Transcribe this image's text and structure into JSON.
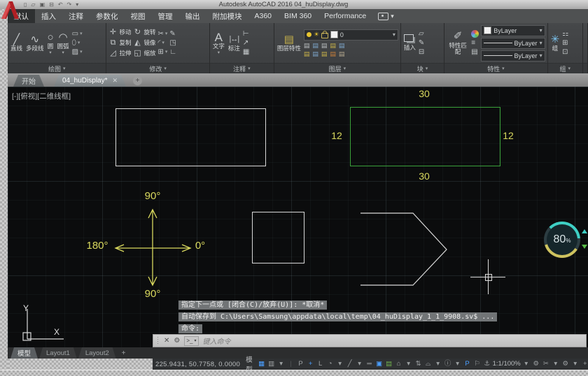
{
  "titlebar": {
    "title": "Autodesk AutoCAD 2016   04_huDisplay.dwg",
    "quick_icons": [
      {
        "name": "new",
        "glyph": "▯"
      },
      {
        "name": "open",
        "glyph": "▱"
      },
      {
        "name": "save",
        "glyph": "▣"
      },
      {
        "name": "plot",
        "glyph": "⊟"
      },
      {
        "name": "undo",
        "glyph": "↶"
      },
      {
        "name": "redo",
        "glyph": "↷"
      },
      {
        "name": "qat-dropdown",
        "glyph": "▾"
      }
    ]
  },
  "ribbon_tabs": [
    {
      "label": "默认"
    },
    {
      "label": "插入"
    },
    {
      "label": "注释"
    },
    {
      "label": "参数化"
    },
    {
      "label": "视图"
    },
    {
      "label": "管理"
    },
    {
      "label": "输出"
    },
    {
      "label": "附加模块"
    },
    {
      "label": "A360"
    },
    {
      "label": "BIM 360"
    },
    {
      "label": "Performance"
    }
  ],
  "ribbon": {
    "draw": {
      "panel_label": "绘图",
      "line": "直线",
      "line_glyph": "╱",
      "polyline": "多段线",
      "polyline_glyph": "∿",
      "circle": "圆",
      "circle_glyph": "○",
      "arc": "圆弧",
      "arc_glyph": "◠",
      "small": [
        {
          "name": "rectangle",
          "glyph": "▭"
        },
        {
          "name": "ellipse",
          "glyph": "⬯"
        },
        {
          "name": "hatch",
          "glyph": "▨"
        }
      ]
    },
    "modify": {
      "panel_label": "修改",
      "col1": [
        {
          "name": "move",
          "glyph": "✛",
          "label": "移动"
        },
        {
          "name": "copy",
          "glyph": "⧉",
          "label": "复制"
        },
        {
          "name": "stretch",
          "glyph": "◿",
          "label": "拉伸"
        }
      ],
      "col2": [
        {
          "name": "rotate",
          "glyph": "↻",
          "label": "旋转"
        },
        {
          "name": "mirror",
          "glyph": "◭",
          "label": "镜像"
        },
        {
          "name": "scale",
          "glyph": "◱",
          "label": "缩放"
        }
      ],
      "small": [
        {
          "name": "trim",
          "glyph": "✂"
        },
        {
          "name": "fillet",
          "glyph": "◜"
        },
        {
          "name": "array",
          "glyph": "⊞"
        }
      ],
      "extra": [
        {
          "name": "erase",
          "glyph": "✎"
        },
        {
          "name": "explode",
          "glyph": "◳"
        },
        {
          "name": "offset",
          "glyph": "∟"
        }
      ]
    },
    "annotate": {
      "panel_label": "注释",
      "text": "文字",
      "text_glyph": "A",
      "dimension": "标注",
      "small": [
        {
          "name": "dim-style",
          "glyph": "⊢"
        },
        {
          "name": "leader",
          "glyph": "↗"
        },
        {
          "name": "table",
          "glyph": "▦"
        }
      ]
    },
    "layers": {
      "panel_label": "图层",
      "properties": "图层特性",
      "properties_glyph": "▤",
      "current_layer": "0",
      "tools_row1": [
        {
          "name": "off",
          "glyph": "▤",
          "color": "#b9bdbf"
        },
        {
          "name": "isolate",
          "glyph": "▤",
          "color": "#7ea7cc"
        },
        {
          "name": "freeze",
          "glyph": "▤",
          "color": "#b9bdbf"
        },
        {
          "name": "lock",
          "glyph": "▤",
          "color": "#c8b24a"
        },
        {
          "name": "make-current",
          "glyph": "▤",
          "color": "#7ea7cc"
        }
      ],
      "tools_row2": [
        {
          "name": "on",
          "glyph": "▤",
          "color": "#c8b24a"
        },
        {
          "name": "unisolate",
          "glyph": "▤",
          "color": "#7ea7cc"
        },
        {
          "name": "thaw",
          "glyph": "▤",
          "color": "#c8b24a"
        },
        {
          "name": "unlock",
          "glyph": "▤",
          "color": "#c87f3a"
        },
        {
          "name": "match",
          "glyph": "▤",
          "color": "#b3a68c"
        }
      ]
    },
    "block": {
      "panel_label": "块",
      "insert": "插入",
      "small": [
        {
          "name": "create-block",
          "glyph": "▱"
        },
        {
          "name": "edit-block",
          "glyph": "✎"
        },
        {
          "name": "attributes",
          "glyph": "⊟"
        }
      ]
    },
    "properties": {
      "panel_label": "特性",
      "match": "特性匹配",
      "color_value": "ByLayer",
      "lineweight_value": "ByLayer",
      "linetype_value": "ByLayer",
      "small": [
        {
          "name": "line-stack",
          "glyph": "≡"
        },
        {
          "name": "hatch-sample",
          "glyph": "▤"
        }
      ]
    },
    "group": {
      "panel_label": "组",
      "group": "组",
      "group_glyph": "✳",
      "small": [
        {
          "name": "ungroup",
          "glyph": "⚏"
        },
        {
          "name": "group-edit",
          "glyph": "⊞"
        },
        {
          "name": "group-select",
          "glyph": "⊡"
        }
      ]
    }
  },
  "file_tabs": {
    "start": "开始",
    "document": "04_huDisplay*",
    "close_glyph": "✕",
    "plus_glyph": "+"
  },
  "canvas": {
    "viewport_label": "[-][俯视][二维线框]",
    "green_rect": {
      "top": "30",
      "bottom": "30",
      "left": "12",
      "right": "12"
    },
    "angles": {
      "up": "90°",
      "down": "90°",
      "left": "180°",
      "right": "0°"
    },
    "ucs": {
      "x": "X",
      "y": "Y"
    },
    "badge": {
      "value": "80",
      "unit": "%"
    }
  },
  "command": {
    "history": [
      "指定下一点或 [闭合(C)/放弃(U)]: *取消*",
      "自动保存到 C:\\Users\\Samsung\\appdata\\local\\temp\\04_huDisplay_1_1_9908.sv$ ...",
      "命令:"
    ],
    "prompt": ">_",
    "placeholder": "键入命令",
    "close_glyph": "✕",
    "customize_glyph": "⚙"
  },
  "layout_tabs": [
    {
      "label": "模型"
    },
    {
      "label": "Layout1"
    },
    {
      "label": "Layout2"
    }
  ],
  "layout_plus": "+",
  "status": {
    "coords": "225.9431, 50.7758, 0.0000",
    "model": "模型",
    "icons": [
      {
        "name": "grid-mode",
        "glyph": "▦",
        "color": "#4a9eff"
      },
      {
        "name": "snap-mode",
        "glyph": "▥"
      },
      {
        "name": "snap-dropdown",
        "glyph": "▾"
      },
      {
        "name": "divider",
        "glyph": "|",
        "color": "#55585a"
      },
      {
        "name": "infer-constraints",
        "glyph": "P"
      },
      {
        "name": "dynamic-input",
        "glyph": "+",
        "color": "#4a9eff"
      },
      {
        "name": "ortho-mode",
        "glyph": "L"
      },
      {
        "name": "polar-tracking",
        "glyph": "◔"
      },
      {
        "name": "polar-dropdown",
        "glyph": "▾"
      },
      {
        "name": "isometric-drafting",
        "glyph": "╱"
      },
      {
        "name": "iso-dropdown",
        "glyph": "▾"
      },
      {
        "name": "lineweight-display",
        "glyph": "═"
      },
      {
        "name": "object-snap",
        "glyph": "▣",
        "color": "#4a9eff"
      },
      {
        "name": "selection-cycling",
        "glyph": "▤",
        "color": "#6fae4e"
      },
      {
        "name": "3d-osnap",
        "glyph": "⌂"
      },
      {
        "name": "osnap-dropdown",
        "glyph": "▾"
      },
      {
        "name": "dynamic-ucs",
        "glyph": "⇅"
      },
      {
        "name": "annotation-visibility",
        "glyph": "⌓"
      },
      {
        "name": "autoscale-dropdown",
        "glyph": "▾"
      },
      {
        "name": "info",
        "glyph": "ⓘ"
      },
      {
        "name": "info-dropdown",
        "glyph": "▾"
      },
      {
        "name": "quick-properties",
        "glyph": "P",
        "color": "#4a9eff"
      },
      {
        "name": "annotation-monitor",
        "glyph": "⚐"
      },
      {
        "name": "units",
        "glyph": "⚓"
      },
      {
        "name": "annotation-scale",
        "glyph": "1:1/100%",
        "color": "#b8bbbd"
      },
      {
        "name": "scale-dropdown",
        "glyph": "▾"
      },
      {
        "name": "workspace",
        "glyph": "⚙"
      },
      {
        "name": "cleanscreen",
        "glyph": "✂"
      },
      {
        "name": "workspace-dropdown",
        "glyph": "▾"
      },
      {
        "name": "customization",
        "glyph": "⚙"
      },
      {
        "name": "customization-dropdown",
        "glyph": "▾"
      },
      {
        "name": "isolate-objects",
        "glyph": "+"
      },
      {
        "name": "hardware-accel",
        "glyph": "▮"
      }
    ]
  },
  "colors": {
    "shape_green": "#3aa13a",
    "annotation_yellow": "#d9d95e",
    "active_icon_blue": "#4a9eff",
    "ring_teal": "#3ecfc4",
    "ring_yellow": "#cfc35f"
  }
}
